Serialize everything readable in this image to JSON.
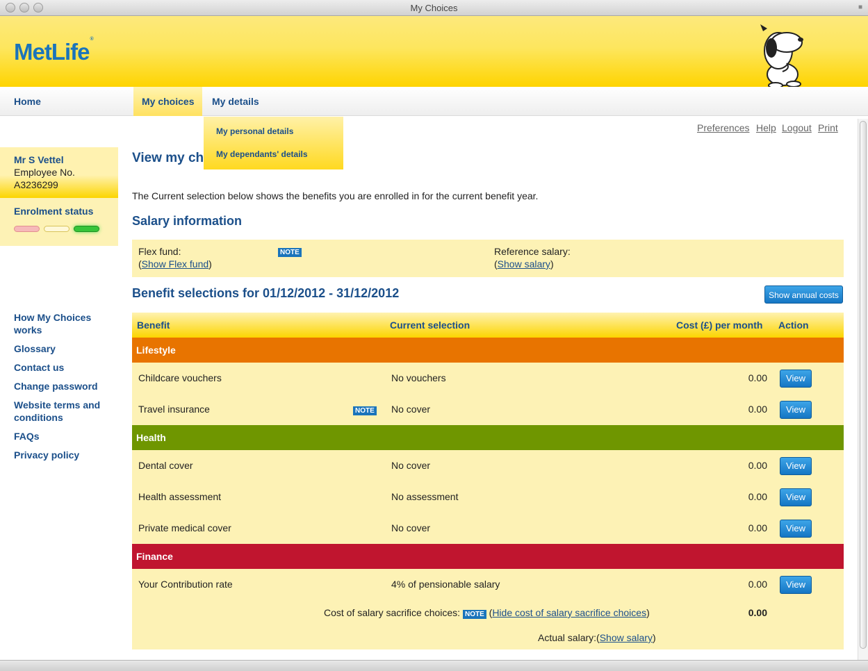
{
  "window": {
    "title": "My Choices"
  },
  "header": {
    "logo": "MetLife",
    "logo_mark": "®"
  },
  "nav": {
    "home": "Home",
    "my_choices": "My choices",
    "my_details": "My details"
  },
  "dropdown": {
    "personal": "My personal details",
    "dependants": "My dependants' details"
  },
  "util": {
    "preferences": "Preferences",
    "help": "Help",
    "logout": "Logout",
    "print": "Print"
  },
  "user": {
    "name": "Mr S Vettel",
    "employee_label": "Employee No.",
    "employee_no": "A3236299",
    "enrolment_title": "Enrolment status",
    "status_colors": [
      "#f6b9b9",
      "#fff3c0",
      "#37c43a"
    ]
  },
  "sidebar": {
    "links": [
      "How My Choices works",
      "Glossary",
      "Contact us",
      "Change password",
      "Website terms and conditions",
      "FAQs",
      "Privacy policy"
    ]
  },
  "main": {
    "view_title": "View my cho",
    "intro": "The Current selection below shows the benefits you are enrolled in for the current benefit year.",
    "salary_title": "Salary information",
    "flex_label": "Flex fund:",
    "flex_link": "Show Flex fund",
    "ref_label": "Reference salary:",
    "ref_link": "Show salary",
    "note": "NOTE",
    "benefit_title": "Benefit selections for 01/12/2012 - 31/12/2012",
    "annual_button": "Show annual costs"
  },
  "table": {
    "headers": {
      "benefit": "Benefit",
      "selection": "Current selection",
      "cost": "Cost (£) per month",
      "action": "Action"
    },
    "view_label": "View",
    "groups": [
      {
        "name": "Lifestyle",
        "color": "#e87400"
      },
      {
        "name": "Health",
        "color": "#6f9600"
      },
      {
        "name": "Finance",
        "color": "#c0152f"
      }
    ],
    "rows": [
      {
        "benefit": "Childcare vouchers",
        "selection": "No vouchers",
        "cost": "0.00"
      },
      {
        "benefit": "Travel insurance",
        "selection": "No cover",
        "cost": "0.00"
      },
      {
        "benefit": "Dental cover",
        "selection": "No cover",
        "cost": "0.00"
      },
      {
        "benefit": "Health assessment",
        "selection": "No assessment",
        "cost": "0.00"
      },
      {
        "benefit": "Private medical cover",
        "selection": "No cover",
        "cost": "0.00"
      },
      {
        "benefit": "Your Contribution rate",
        "selection": "4% of pensionable salary",
        "cost": "0.00"
      }
    ],
    "sacrifice_label": "Cost of salary sacrifice choices:",
    "sacrifice_link": "Hide cost of salary sacrifice choices",
    "sacrifice_total": "0.00",
    "actual_label": "Actual salary:",
    "actual_link": "Show salary"
  }
}
